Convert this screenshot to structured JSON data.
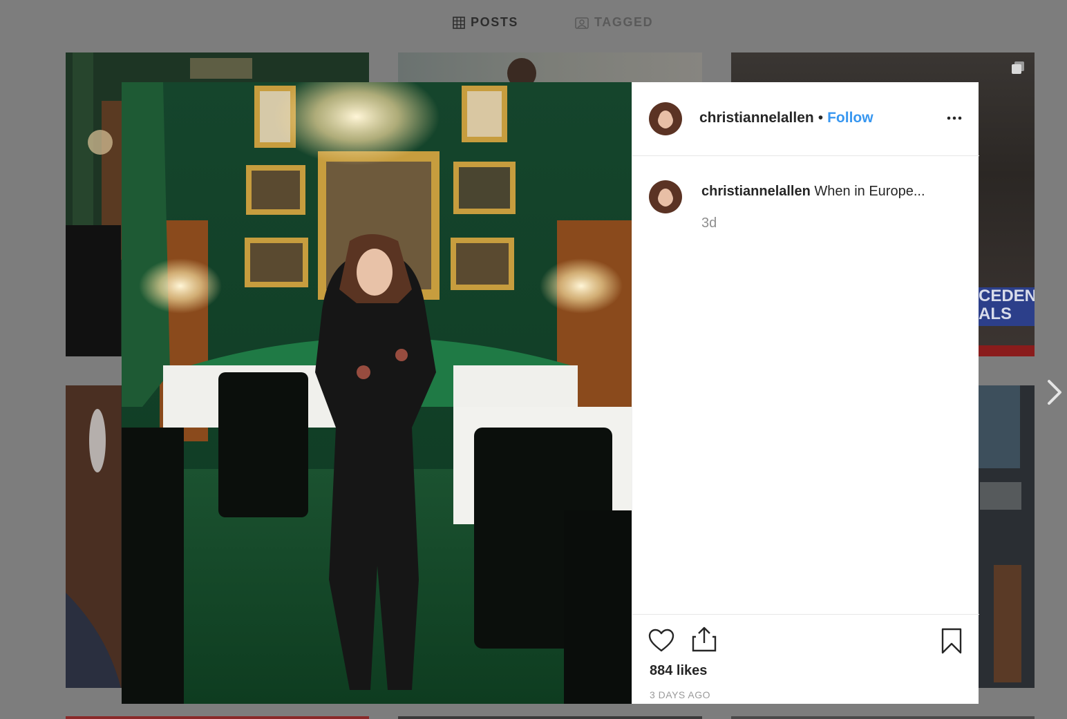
{
  "tabs": [
    {
      "label": "POSTS",
      "icon": "grid-icon"
    },
    {
      "label": "TAGGED",
      "icon": "tagged-icon"
    }
  ],
  "background_tiles": {
    "tile3_banner_text": [
      "CEDENT",
      "ALS"
    ]
  },
  "post": {
    "username": "christiannelallen",
    "separator": "•",
    "follow_label": "Follow",
    "more_icon": "more-options-icon",
    "caption": {
      "username": "christiannelallen",
      "text": "When in Europe...",
      "time": "3d"
    },
    "likes": "884 likes",
    "posted_ago": "3 DAYS AGO",
    "icons": [
      "heart-icon",
      "share-icon",
      "bookmark-icon"
    ]
  },
  "colors": {
    "accent": "#3897f0",
    "overlay": "#7d7d7d",
    "text": "#262626",
    "muted": "#8e8e8e"
  }
}
